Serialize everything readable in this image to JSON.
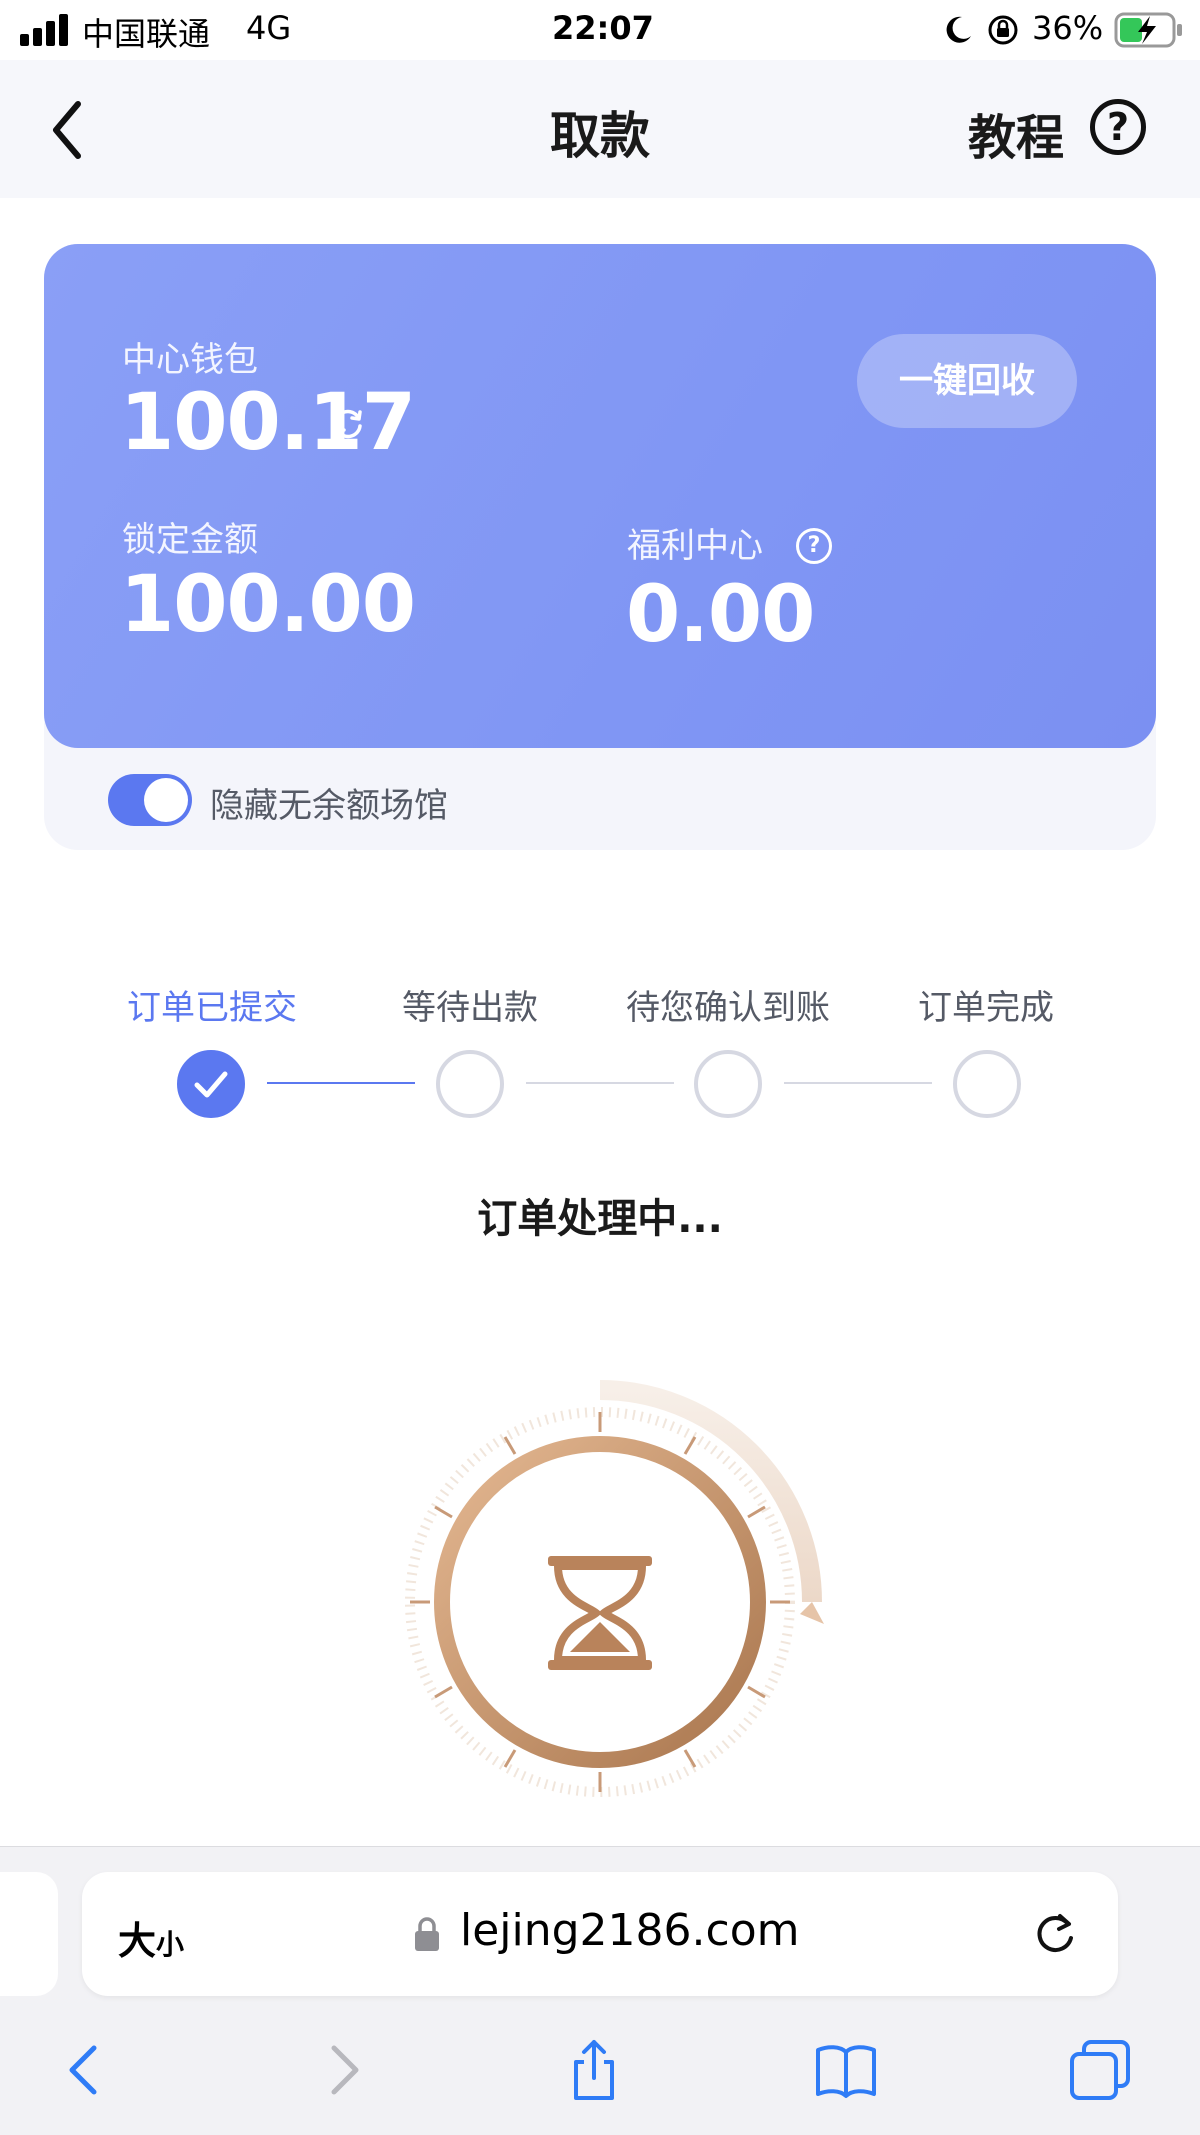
{
  "status_bar": {
    "carrier": "中国联通",
    "network": "4G",
    "time": "22:07",
    "battery": "36%"
  },
  "nav": {
    "title": "取款",
    "tutorial": "教程",
    "help_glyph": "?"
  },
  "wallet": {
    "center_label": "中心钱包",
    "center_value": "100.17",
    "recycle_button": "一键回收",
    "locked_label": "锁定金额",
    "locked_value": "100.00",
    "welfare_label": "福利中心",
    "welfare_value": "0.00",
    "info_glyph": "?"
  },
  "toggle": {
    "label": "隐藏无余额场馆",
    "on": true
  },
  "steps": [
    {
      "label": "订单已提交",
      "done": true
    },
    {
      "label": "等待出款",
      "done": false
    },
    {
      "label": "待您确认到账",
      "done": false
    },
    {
      "label": "订单完成",
      "done": false
    }
  ],
  "processing_text": "订单处理中...",
  "browser": {
    "size_label_big": "大",
    "size_label_small": "小",
    "url": "lejing2186.com"
  },
  "colors": {
    "accent": "#5b78f0",
    "card": "#8096f4",
    "hourglass": "#c48a5c"
  },
  "icons": [
    "back-chevron-icon",
    "help-icon",
    "refresh-icon",
    "info-icon",
    "check-icon",
    "hourglass-icon",
    "lock-icon",
    "reload-icon",
    "back-arrow-icon",
    "forward-arrow-icon",
    "share-icon",
    "bookmarks-icon",
    "tabs-icon"
  ]
}
